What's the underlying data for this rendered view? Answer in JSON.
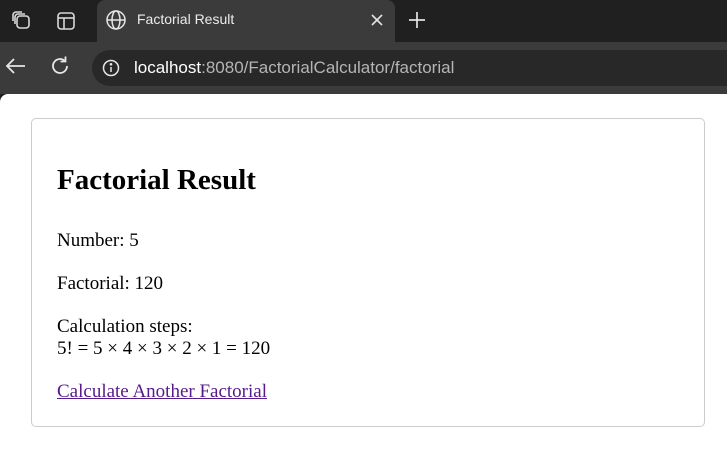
{
  "browser": {
    "tab": {
      "title": "Factorial Result"
    },
    "address": {
      "host": "localhost",
      "rest": ":8080/FactorialCalculator/factorial"
    }
  },
  "page": {
    "heading": "Factorial Result",
    "number_text": "Number: 5",
    "factorial_text": "Factorial: 120",
    "steps_label": "Calculation steps:",
    "steps_formula": "5! = 5 × 4 × 3 × 2 × 1 = 120",
    "link_text": "Calculate Another Factorial"
  }
}
